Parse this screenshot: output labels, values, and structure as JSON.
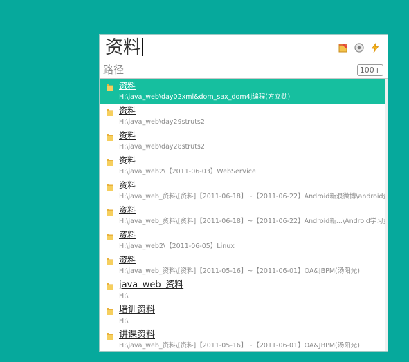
{
  "search": {
    "query": "资料"
  },
  "path_filter": {
    "placeholder": "路径",
    "count_badge": "100+"
  },
  "toolbar": {
    "icons": [
      "note-icon",
      "settings-icon",
      "lightning-icon"
    ]
  },
  "results": [
    {
      "name": "资料",
      "path": "H:\\java_web\\day02xml&dom_sax_dom4j编程(方立勋)",
      "selected": true
    },
    {
      "name": "资料",
      "path": "H:\\java_web\\day29struts2"
    },
    {
      "name": "资料",
      "path": "H:\\java_web\\day28struts2"
    },
    {
      "name": "资料",
      "path": "H:\\java_web2\\【2011-06-03】WebSerVice"
    },
    {
      "name": "资料",
      "path": "H:\\java_web_资料\\[资料]【2011-06-18】~【2011-06-22】Android新浪微博\\android资料"
    },
    {
      "name": "资料",
      "path": "H:\\java_web_资料\\[资料]【2011-06-18】~【2011-06-22】Android新...\\Android学习资料"
    },
    {
      "name": "资料",
      "path": "H:\\java_web2\\【2011-06-05】Linux"
    },
    {
      "name": "资料",
      "path": "H:\\java_web_资料\\[资料]【2011-05-16】~【2011-06-01】OA&JBPM(汤阳光)"
    },
    {
      "name": "java_web_资料",
      "path": "H:\\"
    },
    {
      "name": "培训资料",
      "path": "H:\\"
    },
    {
      "name": "讲课资料",
      "path": "H:\\java_web_资料\\[资料]【2011-05-16】~【2011-06-01】OA&JBPM(汤阳光)"
    }
  ]
}
